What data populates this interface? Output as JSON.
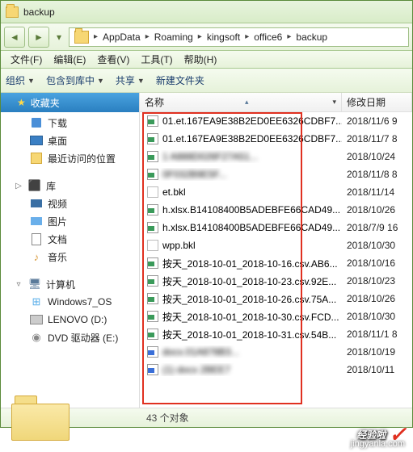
{
  "window": {
    "title": "backup"
  },
  "breadcrumb": [
    "AppData",
    "Roaming",
    "kingsoft",
    "office6",
    "backup"
  ],
  "menus": {
    "file": "文件(F)",
    "edit": "编辑(E)",
    "view": "查看(V)",
    "tools": "工具(T)",
    "help": "帮助(H)"
  },
  "toolbar": {
    "organize": "组织",
    "include": "包含到库中",
    "share": "共享",
    "newfolder": "新建文件夹"
  },
  "sidebar": {
    "favorites": "收藏夹",
    "downloads": "下载",
    "desktop": "桌面",
    "recent": "最近访问的位置",
    "libraries": "库",
    "videos": "视频",
    "pictures": "图片",
    "documents": "文档",
    "music": "音乐",
    "computer": "计算机",
    "win_os": "Windows7_OS",
    "lenovo": "LENOVO (D:)",
    "dvd": "DVD 驱动器 (E:)"
  },
  "columns": {
    "name": "名称",
    "date": "修改日期"
  },
  "files": [
    {
      "icon": "et",
      "name": "01.et.167EA9E38B2ED0EE6326CDBF7...",
      "date": "2018/11/6 9"
    },
    {
      "icon": "et",
      "name": "01.et.167EA9E38B2ED0EE6326CDBF7...",
      "date": "2018/11/7 8"
    },
    {
      "icon": "et",
      "name": "1                           A888D026F27A51...",
      "date": "2018/10/24",
      "blur": true
    },
    {
      "icon": "et",
      "name": "                                  0F032B9E5F...",
      "date": "2018/11/8 8",
      "blur": true
    },
    {
      "icon": "generic",
      "name": "et.bkl",
      "date": "2018/11/14"
    },
    {
      "icon": "et",
      "name": "h.xlsx.B14108400B5ADEBFE66CAD49...",
      "date": "2018/10/26"
    },
    {
      "icon": "et",
      "name": "h.xlsx.B14108400B5ADEBFE66CAD49...",
      "date": "2018/7/9 16"
    },
    {
      "icon": "generic",
      "name": "wpp.bkl",
      "date": "2018/10/30"
    },
    {
      "icon": "et",
      "name": "按天_2018-10-01_2018-10-16.csv.AB6...",
      "date": "2018/10/16"
    },
    {
      "icon": "et",
      "name": "按天_2018-10-01_2018-10-23.csv.92E...",
      "date": "2018/10/23"
    },
    {
      "icon": "et",
      "name": "按天_2018-10-01_2018-10-26.csv.75A...",
      "date": "2018/10/26"
    },
    {
      "icon": "et",
      "name": "按天_2018-10-01_2018-10-30.csv.FCD...",
      "date": "2018/10/30"
    },
    {
      "icon": "et",
      "name": "按天_2018-10-01_2018-10-31.csv.54B...",
      "date": "2018/11/1 8"
    },
    {
      "icon": "doc",
      "name": "                           docx.01A878B3...",
      "date": "2018/10/19",
      "blur": true
    },
    {
      "icon": "doc",
      "name": "                        (1) docx 2BEE7",
      "date": "2018/10/11",
      "blur": true
    }
  ],
  "status": "43 个对象",
  "watermark": {
    "main": "经验啦",
    "sub": "jingyanla.com"
  }
}
